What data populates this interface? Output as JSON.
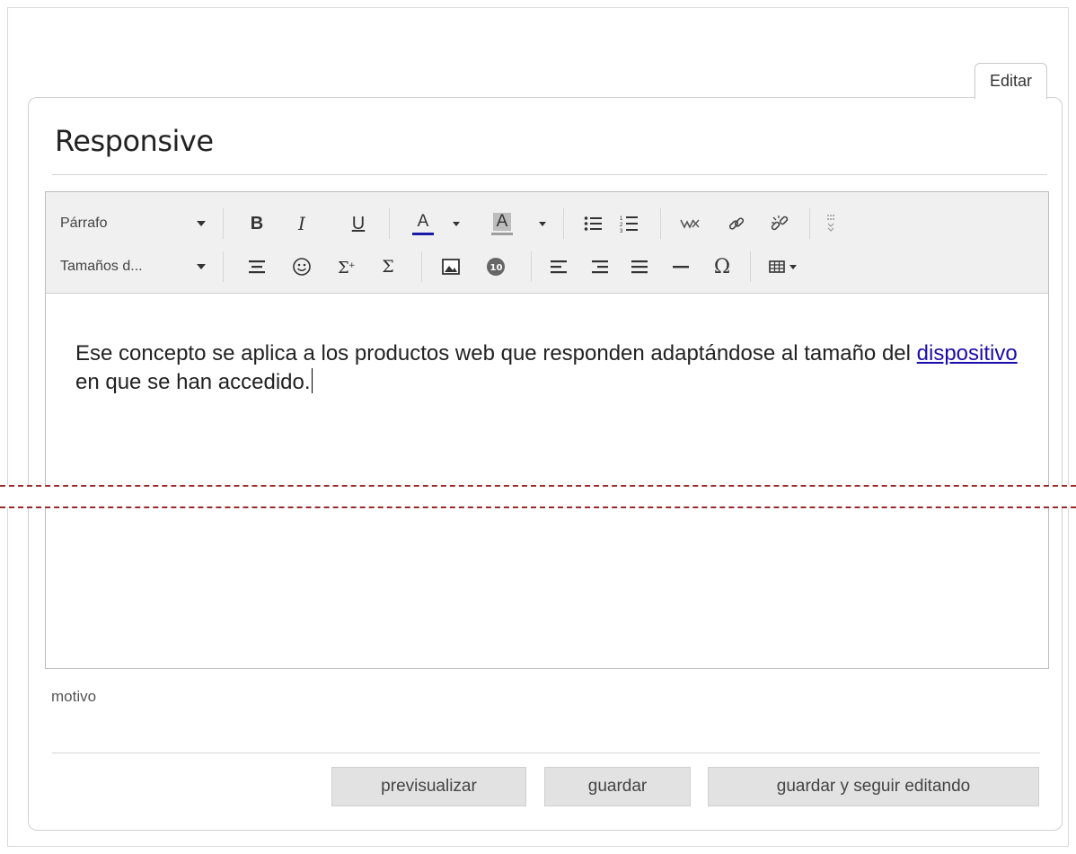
{
  "tabs": {
    "edit_label": "Editar"
  },
  "page": {
    "title": "Responsive"
  },
  "toolbar": {
    "format_select": "Párrafo",
    "size_select": "Tamaños d...",
    "bold_label": "B",
    "italic_label": "I",
    "underline_label": "U",
    "text_color_label": "A",
    "bg_color_label": "A",
    "omega_label": "Ω",
    "sigma_label": "Σ",
    "accent_text_color": "#1a1aa8",
    "bg_color_bar": "#9e9e9e"
  },
  "editor": {
    "text_before_link": "Ese concepto se aplica a los productos web que responden adaptándose al tamaño del ",
    "link_text": "dispositivo",
    "text_after_link": " en que se han accedido."
  },
  "form": {
    "motivo_label": "motivo"
  },
  "buttons": {
    "preview": "previsualizar",
    "save": "guardar",
    "save_continue": "guardar y seguir editando"
  }
}
